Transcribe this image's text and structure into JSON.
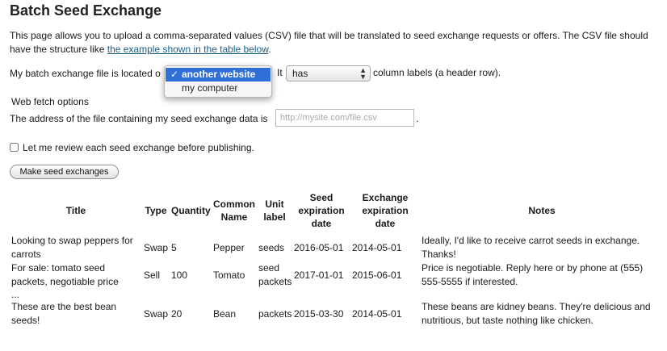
{
  "page": {
    "title": "Batch Seed Exchange",
    "intro_text": "This page allows you to upload a comma-separated values (CSV) file that will be translated to seed exchange requests or offers. The CSV file should have the structure like ",
    "intro_link": "the example shown in the table below",
    "intro_end": "."
  },
  "location": {
    "label": "My batch exchange file is located o",
    "options": [
      "another website",
      "my computer"
    ],
    "selected": "another website",
    "check_glyph": "✓"
  },
  "header_row": {
    "prefix": "It",
    "selected": "has",
    "suffix": "column labels (a header row)."
  },
  "web_fetch": {
    "heading": "Web fetch options",
    "address_label": "The address of the file containing my seed exchange data is",
    "address_placeholder": "http://mysite.com/file.csv",
    "address_value": "",
    "trailing": "."
  },
  "review": {
    "label": "Let me review each seed exchange before publishing.",
    "checked": false
  },
  "submit": {
    "label": "Make seed exchanges"
  },
  "example_table": {
    "columns": [
      "Title",
      "Type",
      "Quantity",
      "Common Name",
      "Unit label",
      "Seed expiration date",
      "Exchange expiration date",
      "Notes"
    ],
    "rows": [
      [
        "Looking to swap peppers for carrots",
        "Swap",
        "5",
        "Pepper",
        "seeds",
        "2016-05-01",
        "2014-05-01",
        "Ideally, I'd like to receive carrot seeds in exchange. Thanks!"
      ],
      [
        "For sale: tomato seed packets, negotiable price",
        "Sell",
        "100",
        "Tomato",
        "seed packets",
        "2017-01-01",
        "2015-06-01",
        "Price is negotiable. Reply here or by phone at (555) 555-5555 if interested."
      ],
      [
        "...",
        "",
        "",
        "",
        "",
        "",
        "",
        ""
      ],
      [
        "These are the best bean seeds!",
        "Swap",
        "20",
        "Bean",
        "packets",
        "2015-03-30",
        "2014-05-01",
        "These beans are kidney beans. They're delicious and nutritious, but taste nothing like chicken."
      ]
    ]
  },
  "colors": {
    "selection_highlight": "#2f6fd8",
    "link": "#1a5f8a"
  }
}
